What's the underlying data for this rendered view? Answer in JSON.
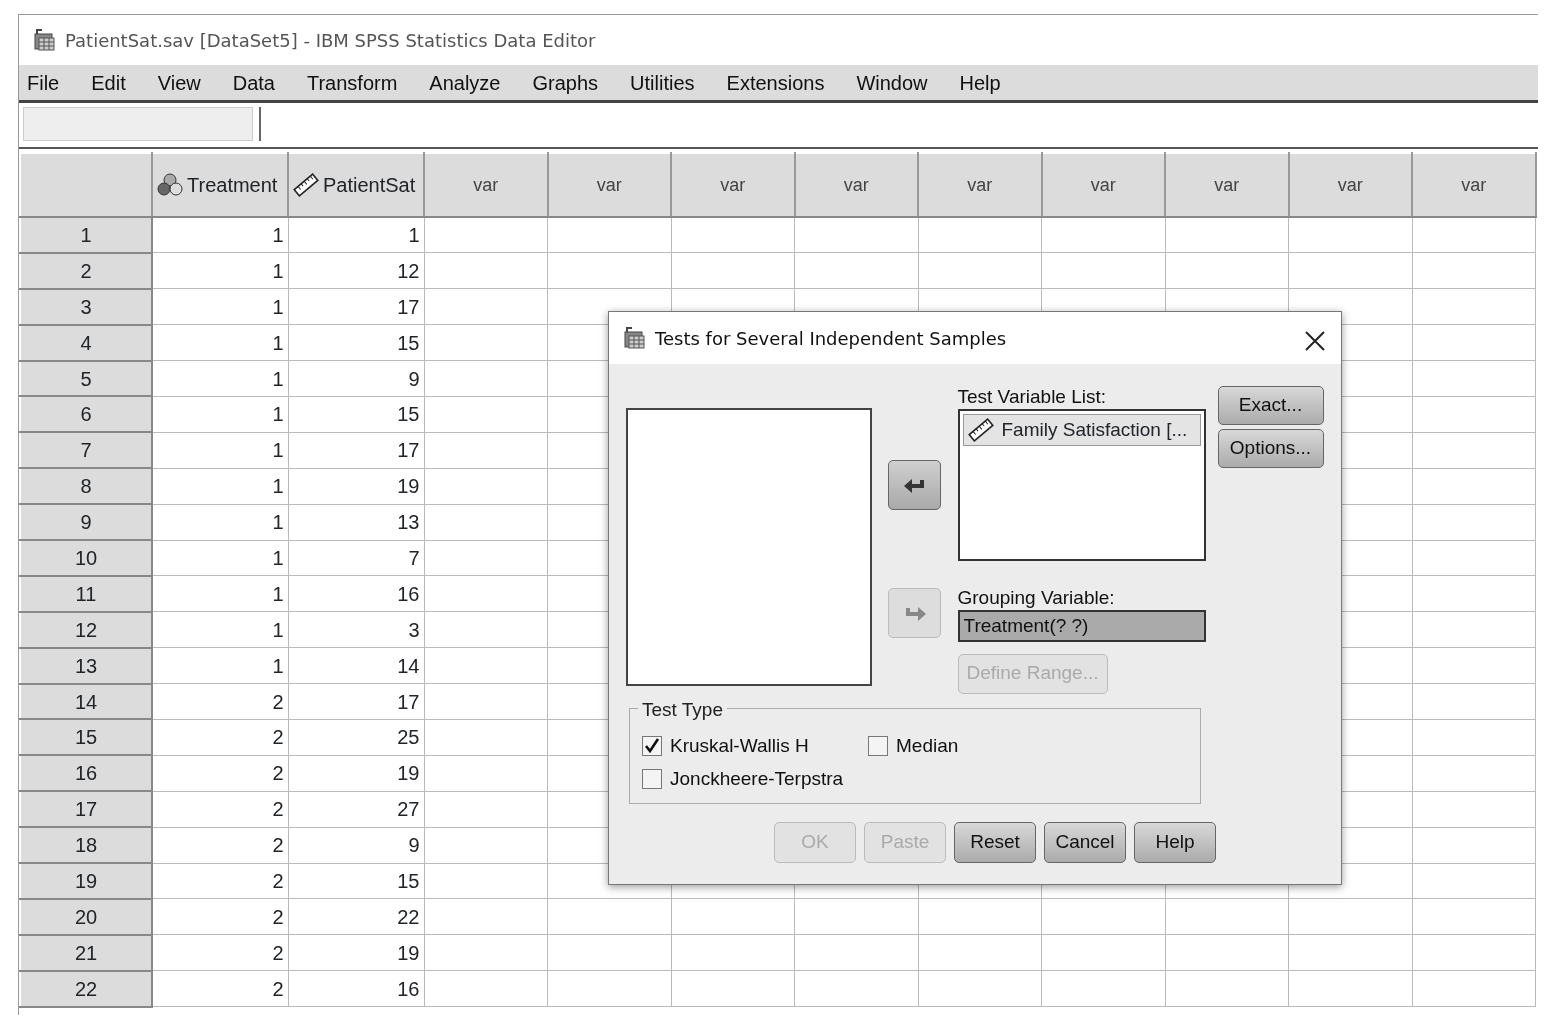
{
  "window": {
    "title": "PatientSat.sav [DataSet5] - IBM SPSS Statistics Data Editor"
  },
  "menu": [
    "File",
    "Edit",
    "View",
    "Data",
    "Transform",
    "Analyze",
    "Graphs",
    "Utilities",
    "Extensions",
    "Window",
    "Help"
  ],
  "grid": {
    "columns": [
      {
        "label": "Treatment",
        "kind": "nominal"
      },
      {
        "label": "PatientSat",
        "kind": "scale"
      },
      {
        "label": "var",
        "kind": "empty"
      },
      {
        "label": "var",
        "kind": "empty"
      },
      {
        "label": "var",
        "kind": "empty"
      },
      {
        "label": "var",
        "kind": "empty"
      },
      {
        "label": "var",
        "kind": "empty"
      },
      {
        "label": "var",
        "kind": "empty"
      },
      {
        "label": "var",
        "kind": "empty"
      },
      {
        "label": "var",
        "kind": "empty"
      },
      {
        "label": "var",
        "kind": "empty"
      }
    ],
    "rows": [
      {
        "number": "1",
        "cells": [
          "1",
          "1"
        ]
      },
      {
        "number": "2",
        "cells": [
          "1",
          "12"
        ]
      },
      {
        "number": "3",
        "cells": [
          "1",
          "17"
        ]
      },
      {
        "number": "4",
        "cells": [
          "1",
          "15"
        ]
      },
      {
        "number": "5",
        "cells": [
          "1",
          "9"
        ]
      },
      {
        "number": "6",
        "cells": [
          "1",
          "15"
        ]
      },
      {
        "number": "7",
        "cells": [
          "1",
          "17"
        ]
      },
      {
        "number": "8",
        "cells": [
          "1",
          "19"
        ]
      },
      {
        "number": "9",
        "cells": [
          "1",
          "13"
        ]
      },
      {
        "number": "10",
        "cells": [
          "1",
          "7"
        ]
      },
      {
        "number": "11",
        "cells": [
          "1",
          "16"
        ]
      },
      {
        "number": "12",
        "cells": [
          "1",
          "3"
        ]
      },
      {
        "number": "13",
        "cells": [
          "1",
          "14"
        ]
      },
      {
        "number": "14",
        "cells": [
          "2",
          "17"
        ]
      },
      {
        "number": "15",
        "cells": [
          "2",
          "25"
        ]
      },
      {
        "number": "16",
        "cells": [
          "2",
          "19"
        ]
      },
      {
        "number": "17",
        "cells": [
          "2",
          "27"
        ]
      },
      {
        "number": "18",
        "cells": [
          "2",
          "9"
        ]
      },
      {
        "number": "19",
        "cells": [
          "2",
          "15"
        ]
      },
      {
        "number": "20",
        "cells": [
          "2",
          "22"
        ]
      },
      {
        "number": "21",
        "cells": [
          "2",
          "19"
        ]
      },
      {
        "number": "22",
        "cells": [
          "2",
          "16"
        ]
      }
    ]
  },
  "dialog": {
    "title": "Tests for Several Independent Samples",
    "move_buttons": [
      {
        "kind": "left",
        "disabled": false
      },
      {
        "kind": "right",
        "disabled": true
      }
    ],
    "test_variable_list": {
      "label": "Test Variable List:",
      "items": [
        {
          "label": "Family Satisfaction [...",
          "kind": "scale",
          "selected": true
        }
      ]
    },
    "grouping_variable": {
      "label": "Grouping Variable:",
      "value": "Treatment(? ?)"
    },
    "define_range": {
      "label": "Define Range...",
      "disabled": true
    },
    "side_buttons": [
      {
        "label": "Exact...",
        "disabled": false
      },
      {
        "label": "Options...",
        "disabled": false
      }
    ],
    "test_type": {
      "legend": "Test Type",
      "options": [
        {
          "label": "Kruskal-Wallis H",
          "checked": true
        },
        {
          "label": "Median",
          "checked": false
        },
        {
          "label": "Jonckheere-Terpstra",
          "checked": false
        }
      ]
    },
    "buttons": [
      {
        "label": "OK",
        "disabled": true
      },
      {
        "label": "Paste",
        "disabled": true
      },
      {
        "label": "Reset",
        "disabled": false
      },
      {
        "label": "Cancel",
        "disabled": false
      },
      {
        "label": "Help",
        "disabled": false
      }
    ]
  }
}
